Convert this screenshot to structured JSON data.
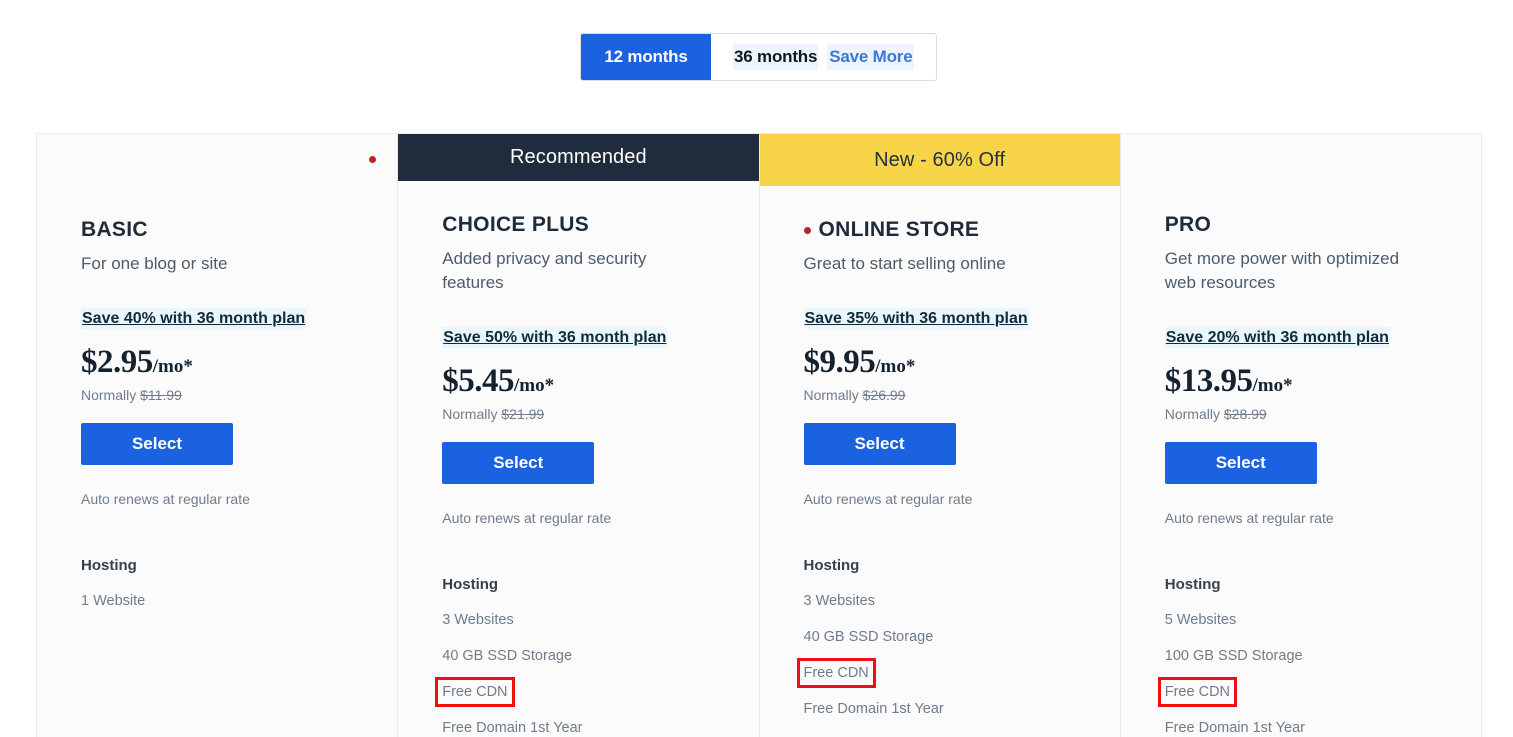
{
  "term_toggle": {
    "options": [
      {
        "label": "12 months",
        "active": true,
        "badge": ""
      },
      {
        "label": "36 months",
        "active": false,
        "badge": "Save More"
      }
    ]
  },
  "colors": {
    "accent_blue": "#1b62e0",
    "banner_navy": "#1f2c3d",
    "banner_yellow": "#f8d548",
    "annotation_red": "#ef1111",
    "marker_red": "#b5282a",
    "save_link_highlight": "#e9f7fa",
    "card_bg": "#fbfbfb",
    "card_border": "#e9ebed"
  },
  "plans": [
    {
      "banner": {
        "label": "",
        "style": "empty"
      },
      "marker_dot": false,
      "floating_marker_dot": true,
      "name": "BASIC",
      "tagline": "For one blog or site",
      "save_link": "Save 40% with 36 month plan",
      "price_amount": "$2.95",
      "price_suffix": "/mo*",
      "normally_prefix": "Normally ",
      "normally_price": "$11.99",
      "select_label": "Select",
      "auto_renew": "Auto renews at regular rate",
      "section_title": "Hosting",
      "features": [
        {
          "label": "1 Website",
          "boxed": false
        }
      ]
    },
    {
      "banner": {
        "label": "Recommended",
        "style": "recommended"
      },
      "marker_dot": false,
      "floating_marker_dot": false,
      "name": "CHOICE PLUS",
      "tagline": "Added privacy and security features",
      "save_link": "Save 50% with 36 month plan",
      "price_amount": "$5.45",
      "price_suffix": "/mo*",
      "normally_prefix": "Normally ",
      "normally_price": "$21.99",
      "select_label": "Select",
      "auto_renew": "Auto renews at regular rate",
      "section_title": "Hosting",
      "features": [
        {
          "label": "3 Websites",
          "boxed": false
        },
        {
          "label": "40 GB SSD Storage",
          "boxed": false
        },
        {
          "label": "Free CDN",
          "boxed": true
        },
        {
          "label": "Free Domain 1st Year",
          "boxed": false
        }
      ]
    },
    {
      "banner": {
        "label": "New - 60% Off",
        "style": "newoff"
      },
      "marker_dot": true,
      "floating_marker_dot": false,
      "name": "ONLINE STORE",
      "tagline": "Great to start selling online",
      "save_link": "Save 35% with 36 month plan",
      "price_amount": "$9.95",
      "price_suffix": "/mo*",
      "normally_prefix": "Normally ",
      "normally_price": "$26.99",
      "select_label": "Select",
      "auto_renew": "Auto renews at regular rate",
      "section_title": "Hosting",
      "features": [
        {
          "label": "3 Websites",
          "boxed": false
        },
        {
          "label": "40 GB SSD Storage",
          "boxed": false
        },
        {
          "label": "Free CDN",
          "boxed": true
        },
        {
          "label": "Free Domain 1st Year",
          "boxed": false
        }
      ]
    },
    {
      "banner": {
        "label": "",
        "style": "empty"
      },
      "marker_dot": false,
      "floating_marker_dot": false,
      "name": "PRO",
      "tagline": "Get more power with optimized web resources",
      "save_link": "Save 20% with 36 month plan",
      "price_amount": "$13.95",
      "price_suffix": "/mo*",
      "normally_prefix": "Normally ",
      "normally_price": "$28.99",
      "select_label": "Select",
      "auto_renew": "Auto renews at regular rate",
      "section_title": "Hosting",
      "features": [
        {
          "label": "5 Websites",
          "boxed": false
        },
        {
          "label": "100 GB SSD Storage",
          "boxed": false
        },
        {
          "label": "Free CDN",
          "boxed": true
        },
        {
          "label": "Free Domain 1st Year",
          "boxed": false
        }
      ]
    }
  ]
}
